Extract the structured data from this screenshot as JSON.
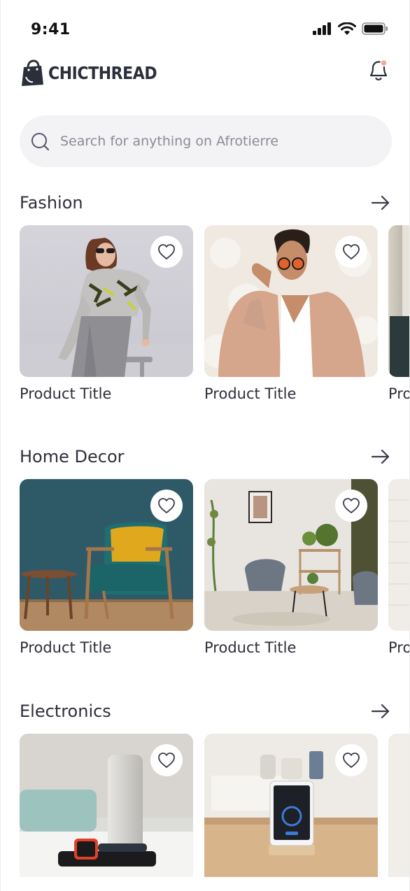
{
  "status_bar": {
    "time": "9:41"
  },
  "header": {
    "brand": "CHICTHREAD"
  },
  "search": {
    "placeholder": "Search for anything on Afrotierre"
  },
  "sections": [
    {
      "title": "Fashion",
      "products": [
        {
          "title": "Product Title",
          "image": "woman-grey-sweater"
        },
        {
          "title": "Product Title",
          "image": "man-pink-blazer"
        },
        {
          "title": "Product Title",
          "image": "partial-street"
        }
      ]
    },
    {
      "title": "Home Decor",
      "products": [
        {
          "title": "Product Title",
          "image": "teal-armchair"
        },
        {
          "title": "Product Title",
          "image": "living-room"
        },
        {
          "title": "Product Title",
          "image": "partial-brick"
        }
      ]
    },
    {
      "title": "Electronics",
      "products": [
        {
          "title": "",
          "image": "speaker-smartwatch"
        },
        {
          "title": "",
          "image": "kitchen-tablet"
        },
        {
          "title": "",
          "image": "partial-kitchen"
        }
      ]
    }
  ],
  "partial_title_fragment": "Pro",
  "colors": {
    "accent_dot": "#f4a79a",
    "text": "#2f2f3a",
    "search_bg": "#f3f3f6"
  },
  "icons": [
    "signal-icon",
    "wifi-icon",
    "battery-icon",
    "bag-logo-icon",
    "bell-icon",
    "search-icon",
    "arrow-right-icon",
    "heart-icon"
  ]
}
